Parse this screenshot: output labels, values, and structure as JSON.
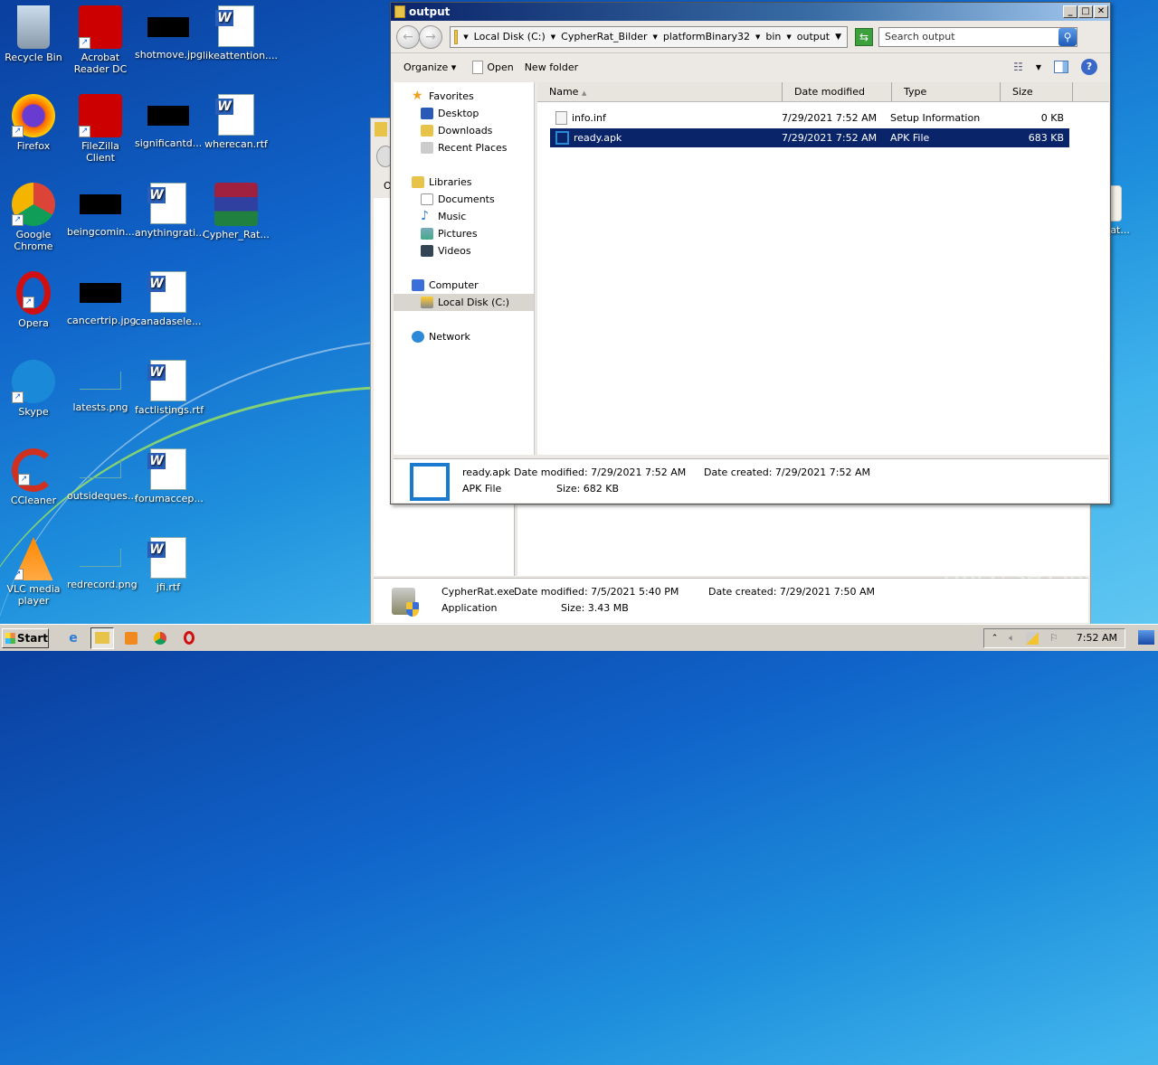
{
  "desktop": {
    "icons": [
      {
        "label": "Recycle Bin",
        "icon": "recycle-bin-icon"
      },
      {
        "label": "Acrobat Reader DC",
        "icon": "acrobat-icon"
      },
      {
        "label": "shotmove.jpg",
        "icon": "image-thumb-icon"
      },
      {
        "label": "likeattention....",
        "icon": "word-doc-icon"
      },
      {
        "label": "Firefox",
        "icon": "firefox-icon"
      },
      {
        "label": "FileZilla Client",
        "icon": "filezilla-icon"
      },
      {
        "label": "significantd...",
        "icon": "image-thumb-icon"
      },
      {
        "label": "wherecan.rtf",
        "icon": "word-doc-icon"
      },
      {
        "label": "Google Chrome",
        "icon": "chrome-icon"
      },
      {
        "label": "beingcomin...",
        "icon": "image-thumb-icon"
      },
      {
        "label": "anythingrati...",
        "icon": "word-doc-icon"
      },
      {
        "label": "Cypher_Rat...",
        "icon": "winrar-icon"
      },
      {
        "label": "Opera",
        "icon": "opera-icon"
      },
      {
        "label": "cancertrip.jpg",
        "icon": "image-thumb-icon"
      },
      {
        "label": "canadasele...",
        "icon": "word-doc-icon"
      },
      {
        "label": "Skype",
        "icon": "skype-icon"
      },
      {
        "label": "latests.png",
        "icon": "image-thumb-icon"
      },
      {
        "label": "factlistings.rtf",
        "icon": "word-doc-icon"
      },
      {
        "label": "CCleaner",
        "icon": "ccleaner-icon"
      },
      {
        "label": "outsideques...",
        "icon": "image-thumb-icon"
      },
      {
        "label": "forumaccep...",
        "icon": "word-doc-icon"
      },
      {
        "label": "VLC media player",
        "icon": "vlc-icon"
      },
      {
        "label": "redrecord.png",
        "icon": "image-thumb-icon"
      },
      {
        "label": "jfi.rtf",
        "icon": "word-doc-icon"
      }
    ],
    "partial_icon_label": "er_Rat..."
  },
  "back_window": {
    "toolbar_letter": "O",
    "details": {
      "name": "CypherRat.exe",
      "date_modified": "Date modified: 7/5/2021 5:40 PM",
      "date_created": "Date created: 7/29/2021 7:50 AM",
      "type": "Application",
      "size": "Size: 3.43 MB"
    }
  },
  "explorer": {
    "title": "output",
    "address": [
      "Local Disk (C:)",
      "CypherRat_Bilder",
      "platformBinary32",
      "bin",
      "output"
    ],
    "search_placeholder": "Search output",
    "toolbar": {
      "organize": "Organize",
      "open": "Open",
      "new_folder": "New folder"
    },
    "nav": {
      "favorites": "Favorites",
      "favorites_items": [
        "Desktop",
        "Downloads",
        "Recent Places"
      ],
      "libraries": "Libraries",
      "libraries_items": [
        "Documents",
        "Music",
        "Pictures",
        "Videos"
      ],
      "computer": "Computer",
      "computer_items": [
        "Local Disk (C:)"
      ],
      "network": "Network"
    },
    "columns": [
      "Name",
      "Date modified",
      "Type",
      "Size"
    ],
    "files": [
      {
        "name": "info.inf",
        "date": "7/29/2021 7:52 AM",
        "type": "Setup Information",
        "size": "0 KB",
        "selected": false
      },
      {
        "name": "ready.apk",
        "date": "7/29/2021 7:52 AM",
        "type": "APK File",
        "size": "683 KB",
        "selected": true
      }
    ],
    "details": {
      "name": "ready.apk",
      "date_modified": "Date modified: 7/29/2021 7:52 AM",
      "date_created": "Date created: 7/29/2021 7:52 AM",
      "type": "APK File",
      "size": "Size: 682 KB"
    }
  },
  "taskbar": {
    "start": "Start",
    "clock": "7:52 AM"
  },
  "watermark": "ANY▷RUN"
}
